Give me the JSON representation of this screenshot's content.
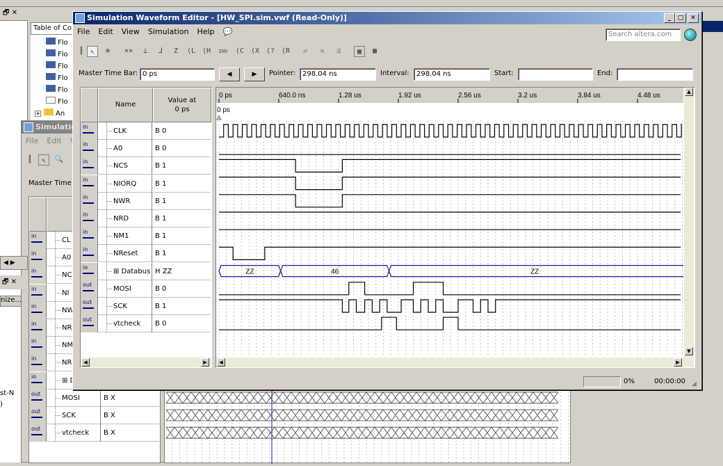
{
  "main_window": {
    "title": "Simulation Waveform Editor - [HW_SPI.sim.vwf (Read-Only)]",
    "menu": [
      "File",
      "Edit",
      "View",
      "Simulation",
      "Help"
    ],
    "search_placeholder": "Search altera.com",
    "master_time_bar_label": "Master Time Bar:",
    "master_time_bar_value": "0 ps",
    "pointer_label": "Pointer:",
    "pointer_value": "298.04 ns",
    "interval_label": "Interval:",
    "interval_value": "298.04 ns",
    "start_label": "Start:",
    "start_value": "",
    "end_label": "End:",
    "end_value": "",
    "col_name": "Name",
    "col_value": "Value at\n0 ps",
    "time_marker": "0 ps",
    "time_ticks": [
      "0 ps",
      "640.0 ns",
      "1.28 us",
      "1.92 us",
      "2.56 us",
      "3.2 us",
      "3.84 us",
      "4.48 us"
    ],
    "signals": [
      {
        "dir": "in",
        "name": "CLK",
        "value": "B 0"
      },
      {
        "dir": "in",
        "name": "A0",
        "value": "B 0"
      },
      {
        "dir": "in",
        "name": "NCS",
        "value": "B 1"
      },
      {
        "dir": "in",
        "name": "NIORQ",
        "value": "B 1"
      },
      {
        "dir": "in",
        "name": "NWR",
        "value": "B 1"
      },
      {
        "dir": "in",
        "name": "NRD",
        "value": "B 1"
      },
      {
        "dir": "in",
        "name": "NM1",
        "value": "B 1"
      },
      {
        "dir": "in",
        "name": "NReset",
        "value": "B 1"
      },
      {
        "dir": "io",
        "name": "Databus",
        "value": "H ZZ"
      },
      {
        "dir": "out",
        "name": "MOSI",
        "value": "B 0"
      },
      {
        "dir": "out",
        "name": "SCK",
        "value": "B 1"
      },
      {
        "dir": "out",
        "name": "vtcheck",
        "value": "B 0"
      }
    ],
    "bus_labels": [
      "ZZ",
      "46",
      "ZZ"
    ],
    "status_percent": "0%",
    "status_time": "00:00:00"
  },
  "back_window": {
    "title": "Simulation",
    "menu": [
      "File",
      "Edit",
      "V"
    ],
    "master_time_label": "Master Time",
    "signals": [
      {
        "dir": "in",
        "name": "CL",
        "value": ""
      },
      {
        "dir": "in",
        "name": "A0",
        "value": ""
      },
      {
        "dir": "in",
        "name": "NC",
        "value": ""
      },
      {
        "dir": "in",
        "name": "NI",
        "value": ""
      },
      {
        "dir": "in",
        "name": "NW",
        "value": ""
      },
      {
        "dir": "in",
        "name": "NR",
        "value": ""
      },
      {
        "dir": "in",
        "name": "NM",
        "value": ""
      },
      {
        "dir": "in",
        "name": "NR",
        "value": ""
      },
      {
        "dir": "io",
        "name": "Da",
        "value": ""
      },
      {
        "dir": "out",
        "name": "MOSI",
        "value": "B X"
      },
      {
        "dir": "out",
        "name": "SCK",
        "value": "B X"
      },
      {
        "dir": "out",
        "name": "vtcheck",
        "value": "B X"
      }
    ]
  },
  "project": {
    "tab_label": "Table of Co",
    "items": [
      "Flo",
      "Flo",
      "Flo",
      "Flo",
      "Flo",
      "Flo",
      "An"
    ]
  },
  "left_fragments": {
    "nize": "nize...",
    "stn": "st-N",
    ")": ")"
  }
}
